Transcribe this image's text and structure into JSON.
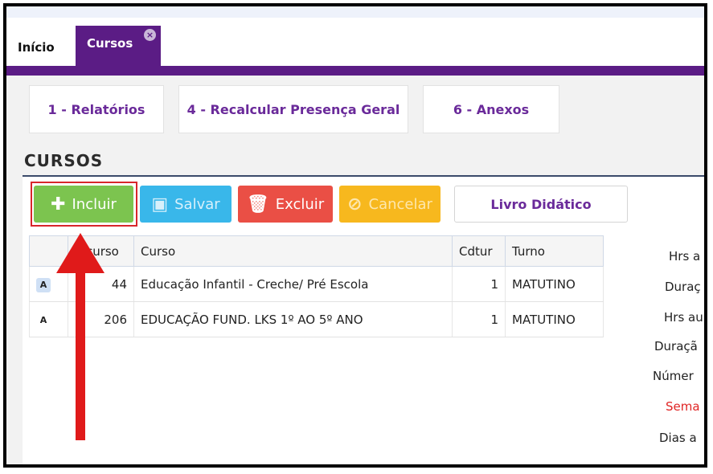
{
  "tabs": [
    {
      "label": "Início"
    },
    {
      "label": "Cursos",
      "close": "×"
    }
  ],
  "menu": {
    "btn1": "1 - Relatórios",
    "btn2": "4 - Recalcular Presença Geral",
    "btn3": "6 - Anexos"
  },
  "section_title": "CURSOS",
  "toolbar": {
    "incluir": "Incluir",
    "salvar": "Salvar",
    "excluir": "Excluir",
    "cancelar": "Cancelar",
    "livro": "Livro Didático"
  },
  "table": {
    "headers": [
      "",
      "Idcurso",
      "Curso",
      "Cdtur",
      "Turno"
    ],
    "rows": [
      {
        "mark": "A",
        "idcurso": "44",
        "curso": "Educação Infantil - Creche/ Pré Escola",
        "cdtur": "1",
        "turno": "MATUTINO"
      },
      {
        "mark": "A",
        "idcurso": "206",
        "curso": "EDUCAÇÃO FUND. LKS 1º AO 5º ANO",
        "cdtur": "1",
        "turno": "MATUTINO"
      }
    ]
  },
  "side_labels": [
    "Hrs a",
    "Duraç",
    "Hrs au",
    "Duraçã",
    "Númer",
    "Sema",
    "Dias a"
  ],
  "colors": {
    "brand": "#5b1c85",
    "incluir": "#7cc44f",
    "excluir": "#ea4f45",
    "arrow": "#e01a1a"
  }
}
